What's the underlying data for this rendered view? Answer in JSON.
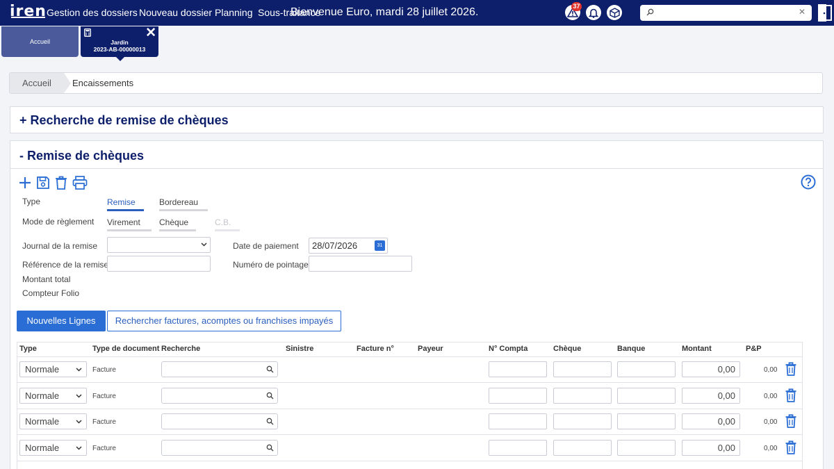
{
  "topbar": {
    "logo": "iren",
    "nav": [
      "Gestion des dossiers",
      "Nouveau dossier",
      "Planning",
      "Sous-traitance"
    ],
    "welcome": "Bienvenue Euro, mardi 28 juillet 2026.",
    "alert_count": "37",
    "search_value": ""
  },
  "tabs": {
    "home": "Accueil",
    "active_line1": "Jardin",
    "active_line2": "2023-AB-00000013"
  },
  "breadcrumb": {
    "home": "Accueil",
    "current": "Encaissements"
  },
  "panels": {
    "search_title": "+ Recherche de remise de chèques",
    "remise_title": "- Remise de chèques"
  },
  "form": {
    "type_label": "Type",
    "type_options": [
      "Remise",
      "Bordereau"
    ],
    "mode_label": "Mode de règlement",
    "mode_options": [
      "Virement",
      "Chèque",
      "C.B."
    ],
    "journal_label": "Journal de la remise",
    "journal_value": "",
    "reference_label": "Référence de la remise",
    "reference_value": "",
    "montant_label": "Montant total",
    "compteur_label": "Compteur Folio",
    "date_label": "Date de paiement",
    "date_value": "28/07/2026",
    "pointage_label": "Numéro de pointage",
    "pointage_value": ""
  },
  "buttons": {
    "new_lines": "Nouvelles Lignes",
    "search_invoices": "Rechercher factures, acomptes ou franchises impayés"
  },
  "table": {
    "headers": [
      "Type",
      "Type de document",
      "Recherche",
      "Sinistre",
      "Facture n°",
      "Payeur",
      "N° Compta",
      "Chèque",
      "Banque",
      "Montant",
      "P&P"
    ],
    "rows": [
      {
        "type": "Normale",
        "doc": "Facture",
        "montant": "0,00",
        "pp": "0,00"
      },
      {
        "type": "Normale",
        "doc": "Facture",
        "montant": "0,00",
        "pp": "0,00"
      },
      {
        "type": "Normale",
        "doc": "Facture",
        "montant": "0,00",
        "pp": "0,00"
      },
      {
        "type": "Normale",
        "doc": "Facture",
        "montant": "0,00",
        "pp": "0,00"
      }
    ]
  },
  "colors": {
    "navy": "#0d1f6b",
    "accent": "#2a6dd4"
  }
}
